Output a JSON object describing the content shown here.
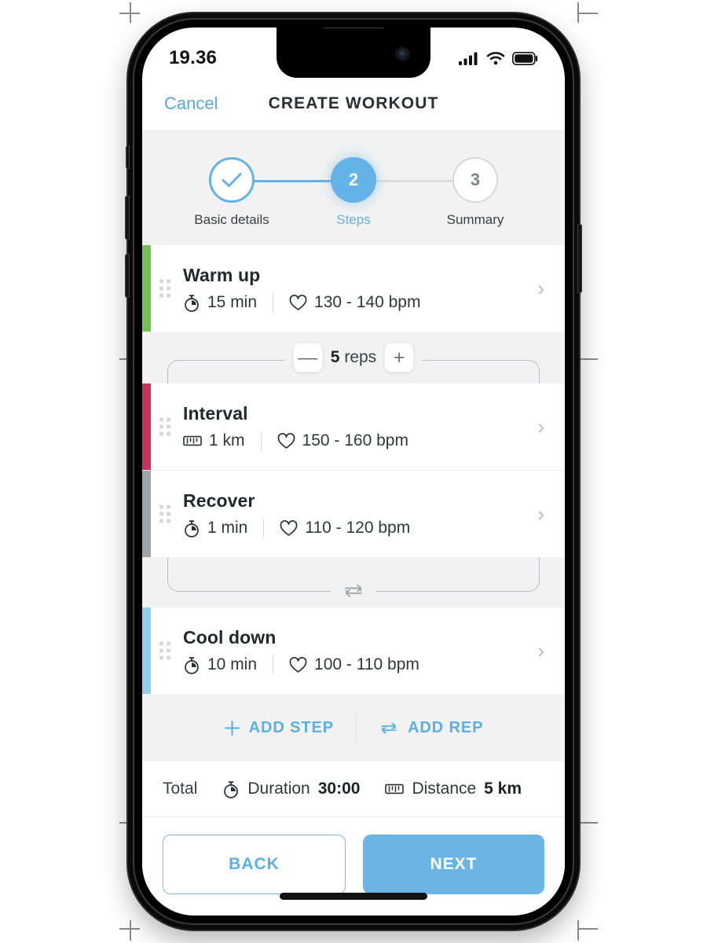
{
  "status_bar": {
    "time": "19.36",
    "icons": [
      "cellular-signal-icon",
      "wifi-icon",
      "battery-icon"
    ]
  },
  "nav": {
    "cancel_label": "Cancel",
    "title": "CREATE WORKOUT"
  },
  "stepper": {
    "steps": [
      {
        "label": "Basic details",
        "indicator": "✓",
        "state": "completed"
      },
      {
        "label": "Steps",
        "indicator": "2",
        "state": "active"
      },
      {
        "label": "Summary",
        "indicator": "3",
        "state": "upcoming"
      }
    ]
  },
  "workout_steps": [
    {
      "title": "Warm up",
      "metric_icon": "stopwatch-icon",
      "metric_value": "15 min",
      "hr_icon": "heart-icon",
      "hr_value": "130 - 140 bpm",
      "accent_color": "#73c354"
    },
    {
      "title": "Interval",
      "metric_icon": "ruler-icon",
      "metric_value": "1 km",
      "hr_icon": "heart-icon",
      "hr_value": "150 - 160 bpm",
      "accent_color": "#c9325c"
    },
    {
      "title": "Recover",
      "metric_icon": "stopwatch-icon",
      "metric_value": "1 min",
      "hr_icon": "heart-icon",
      "hr_value": "110 - 120 bpm",
      "accent_color": "#9fa4a8"
    },
    {
      "title": "Cool down",
      "metric_icon": "stopwatch-icon",
      "metric_value": "10 min",
      "hr_icon": "heart-icon",
      "hr_value": "100 - 110 bpm",
      "accent_color": "#92cdec"
    }
  ],
  "rep_group": {
    "decrement_label": "—",
    "increment_label": "+",
    "count": "5",
    "unit": "reps",
    "loop_icon": "repeat-icon"
  },
  "actions": {
    "add_step_label": "ADD STEP",
    "add_step_icon": "plus-icon",
    "add_rep_label": "ADD REP",
    "add_rep_icon": "repeat-icon"
  },
  "total": {
    "label": "Total",
    "duration_icon": "stopwatch-icon",
    "duration_label": "Duration",
    "duration_value": "30:00",
    "distance_icon": "ruler-icon",
    "distance_label": "Distance",
    "distance_value": "5 km"
  },
  "footer": {
    "back_label": "BACK",
    "next_label": "NEXT"
  },
  "colors": {
    "brand_blue": "#65b2e8",
    "next_button": "#6bb5e4",
    "panel_gray": "#f2f2f2"
  }
}
